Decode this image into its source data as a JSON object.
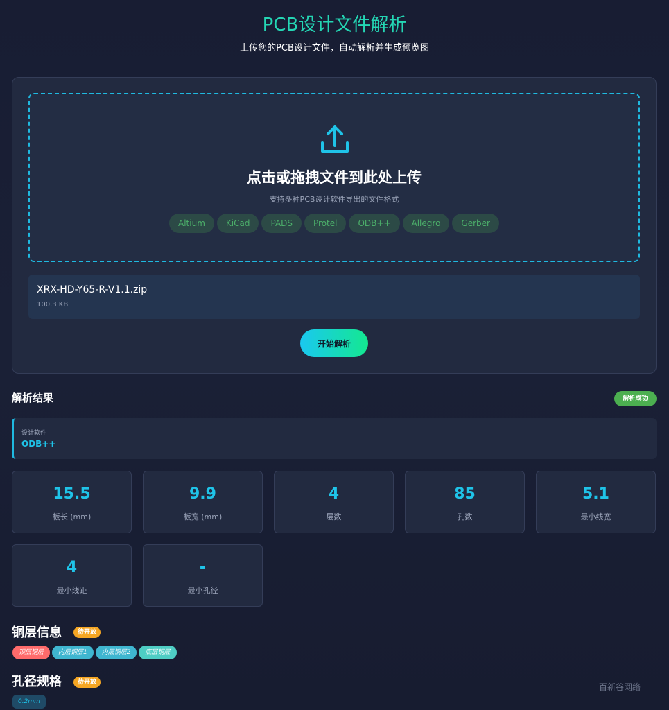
{
  "header": {
    "title": "PCB设计文件解析",
    "subtitle": "上传您的PCB设计文件，自动解析并生成预览图"
  },
  "upload": {
    "icon": "upload-icon",
    "title": "点击或拖拽文件到此处上传",
    "hint": "支持多种PCB设计软件导出的文件格式",
    "formats": [
      "Altium",
      "KiCad",
      "PADS",
      "Protel",
      "ODB++",
      "Allegro",
      "Gerber"
    ],
    "colors": {
      "accent": "#1fb9e0",
      "format_text": "#4caf6a"
    }
  },
  "file": {
    "name": "XRX-HD-Y65-R-V1.1.zip",
    "size": "100.3 KB"
  },
  "parse_button": {
    "label": "开始解析"
  },
  "results": {
    "title": "解析结果",
    "status": "解析成功",
    "software_label": "设计软件",
    "software_value": "ODB++",
    "stats": [
      {
        "value": "15.5",
        "label": "板长 (mm)"
      },
      {
        "value": "9.9",
        "label": "板宽 (mm)"
      },
      {
        "value": "4",
        "label": "层数"
      },
      {
        "value": "85",
        "label": "孔数"
      },
      {
        "value": "5.1",
        "label": "最小线宽"
      },
      {
        "value": "4",
        "label": "最小线距"
      },
      {
        "value": "-",
        "label": "最小孔径"
      }
    ]
  },
  "copper": {
    "title": "铜层信息",
    "badge": "待开放",
    "layers": [
      "顶层铜层",
      "内层铜层1",
      "内层铜层2",
      "底层铜层"
    ]
  },
  "holes": {
    "title": "孔径规格",
    "badge": "待开放",
    "sizes": [
      "0.2mm"
    ]
  },
  "watermark": "百新谷网络"
}
